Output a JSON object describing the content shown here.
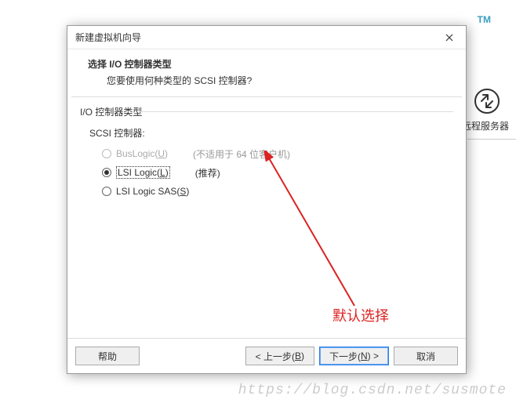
{
  "background": {
    "tm": "TM",
    "remote_label": "远程服务器"
  },
  "dialog": {
    "title": "新建虚拟机向导",
    "header": {
      "title": "选择 I/O 控制器类型",
      "subtitle": "您要使用何种类型的 SCSI 控制器?"
    },
    "group_label": "I/O 控制器类型",
    "scsi_label": "SCSI 控制器:",
    "options": [
      {
        "label_pre": "BusLogic(",
        "mnemonic": "U",
        "label_post": ")",
        "note": "(不适用于 64 位客户机)",
        "disabled": true,
        "selected": false
      },
      {
        "label_pre": "LSI Logic(",
        "mnemonic": "L",
        "label_post": ")",
        "note": "(推荐)",
        "disabled": false,
        "selected": true
      },
      {
        "label_pre": "LSI Logic SAS(",
        "mnemonic": "S",
        "label_post": ")",
        "note": "",
        "disabled": false,
        "selected": false
      }
    ],
    "annotation": "默认选择",
    "buttons": {
      "help": "帮助",
      "back_pre": "< 上一步(",
      "back_mn": "B",
      "back_post": ")",
      "next_pre": "下一步(",
      "next_mn": "N",
      "next_post": ") >",
      "cancel": "取消"
    }
  },
  "watermark": "https://blog.csdn.net/susmote"
}
